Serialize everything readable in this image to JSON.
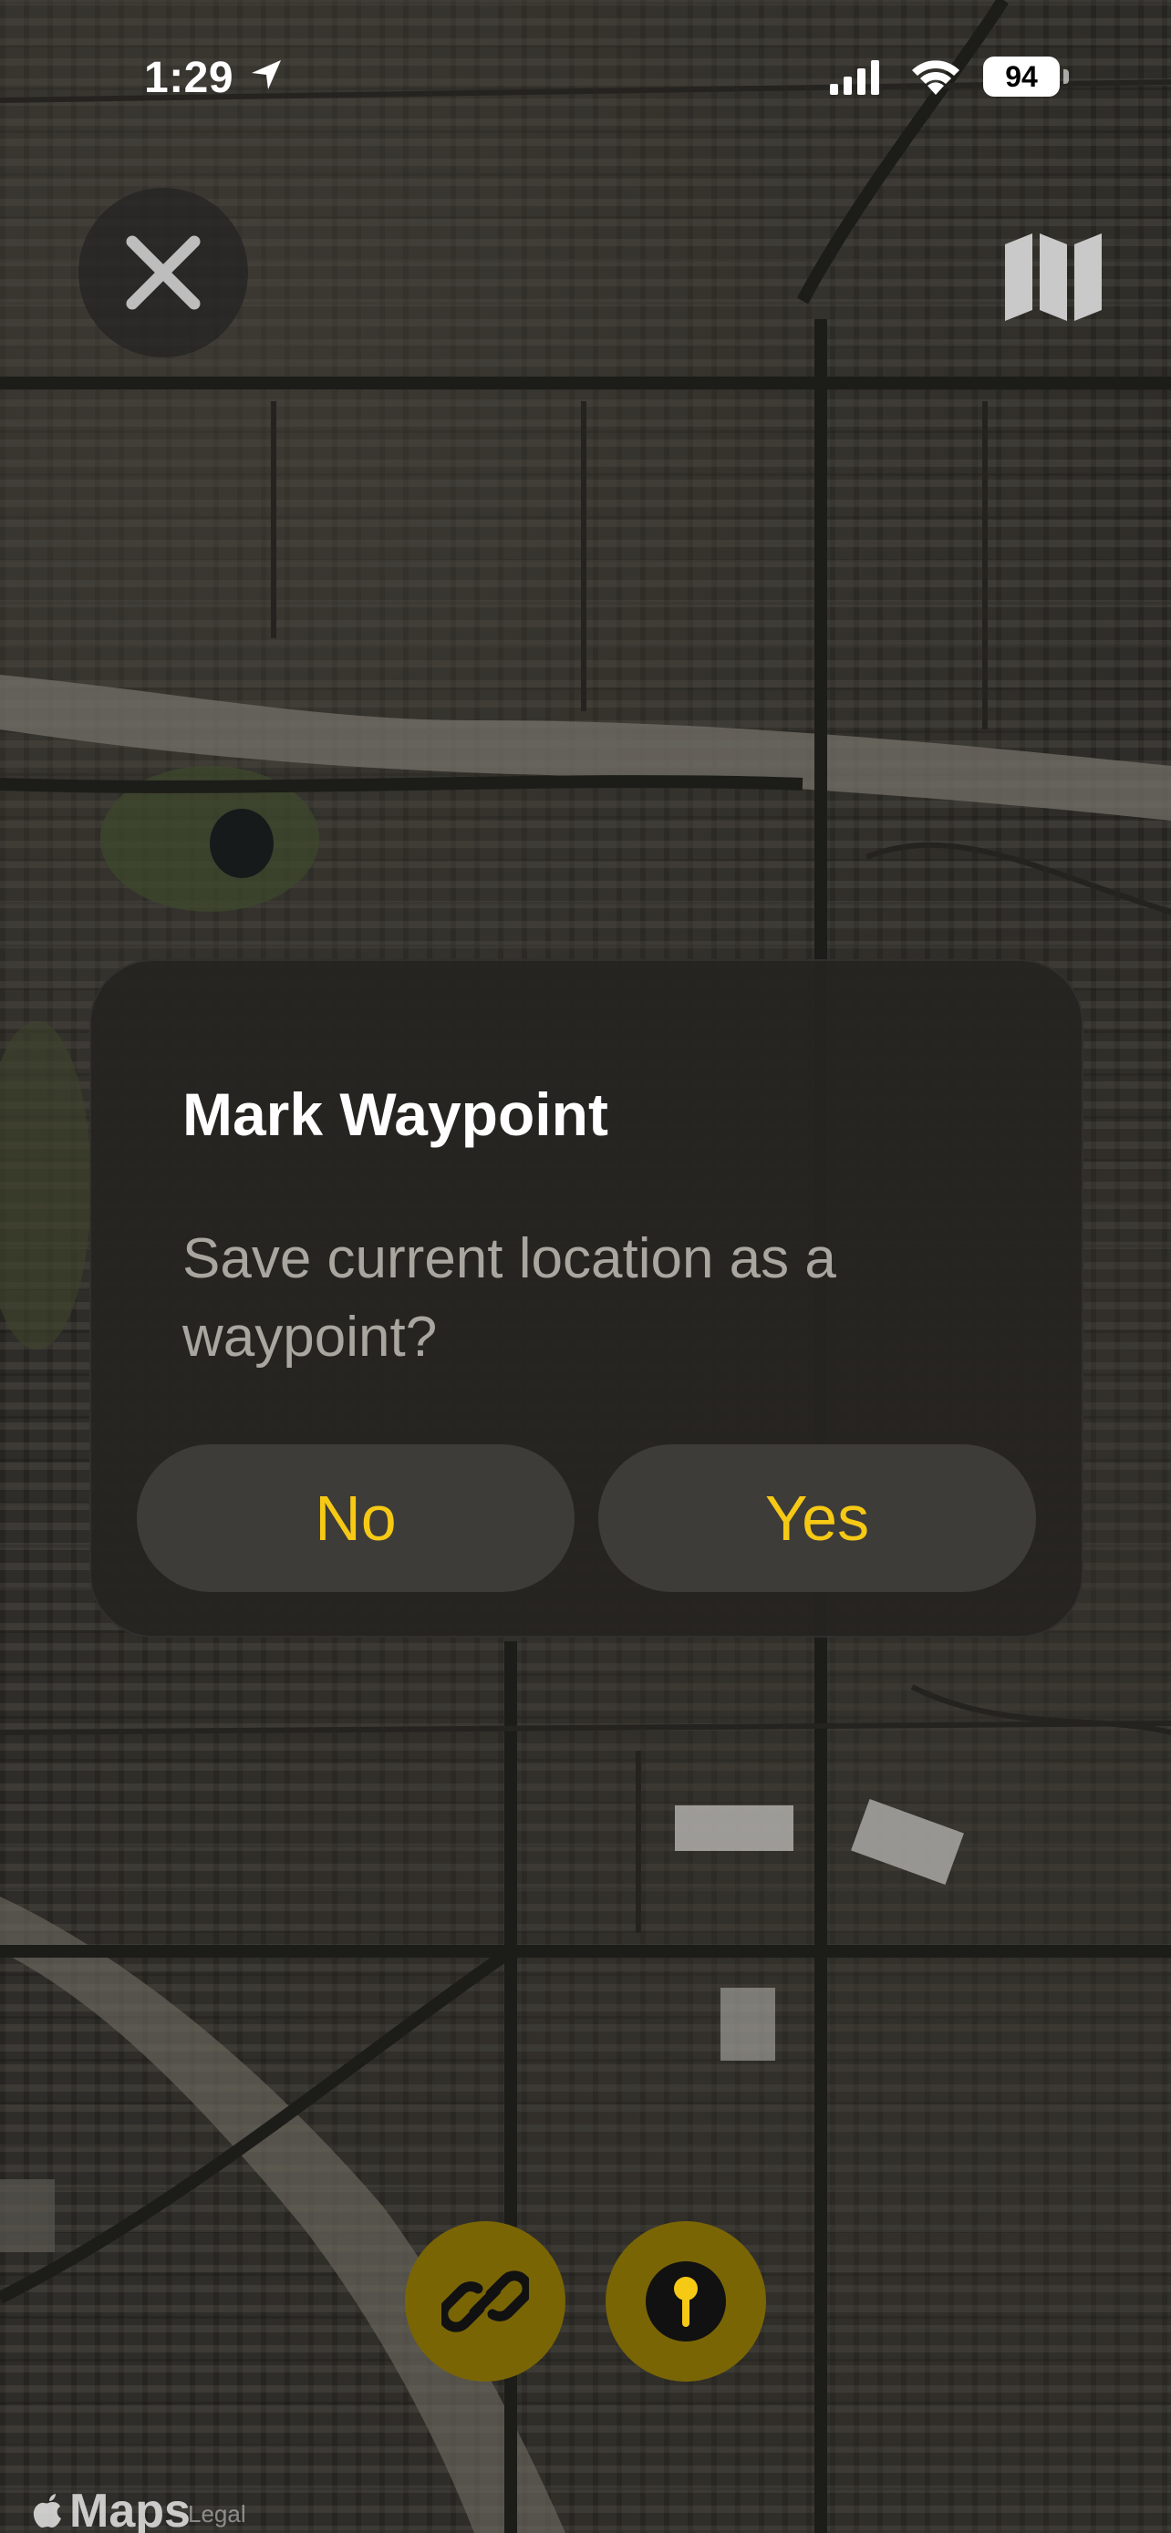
{
  "status_bar": {
    "time": "1:29",
    "battery_level": "94",
    "icons": [
      "location-arrow-icon",
      "cellular-signal-icon",
      "wifi-icon",
      "battery-icon"
    ]
  },
  "top_controls": {
    "close_icon": "close-icon",
    "map_style_icon": "map-icon"
  },
  "dialog": {
    "title": "Mark Waypoint",
    "message": "Save current location as a waypoint?",
    "no_label": "No",
    "yes_label": "Yes"
  },
  "bottom_actions": {
    "share_icon": "link-icon",
    "waypoint_icon": "pin-icon"
  },
  "map_attribution": {
    "logo_text": "Maps",
    "legal_text": "Legal"
  },
  "colors": {
    "accent_yellow": "#f6c915",
    "action_button_bg": "#7a6505",
    "dialog_bg": "#262421"
  }
}
